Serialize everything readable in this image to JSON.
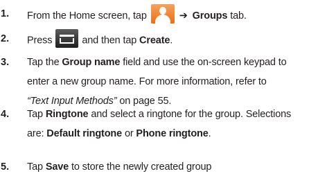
{
  "steps": [
    {
      "num": "1.",
      "lines": [
        {
          "a": "From the Home screen, tap",
          "arrow": "➔",
          "b": "Groups",
          "c": "tab."
        }
      ],
      "icon": "contacts-icon"
    },
    {
      "num": "2.",
      "lines": [
        {
          "a": "Press",
          "b": "and then tap",
          "bold": "Create",
          "c": "."
        }
      ],
      "icon": "menu-icon"
    },
    {
      "num": "3.",
      "lines": [
        {
          "pre": "Tap the",
          "bold": "Group name",
          "post": "field and use the on-screen keypad to"
        },
        {
          "text": "enter a new group name. For more information, refer to"
        },
        {
          "italic": "“Text Input Methods”",
          "post": " on page 55."
        }
      ]
    },
    {
      "num": "4.",
      "lines": [
        {
          "pre": "Tap",
          "bold": "Ringtone",
          "post": "and select a ringtone for the group. Selections"
        },
        {
          "pre": "are:",
          "bold": "Default ringtone",
          "mid": "or",
          "bold2": "Phone ringtone",
          "post": "."
        }
      ]
    },
    {
      "num": "5.",
      "lines": [
        {
          "pre": "Tap",
          "bold": "Save",
          "post": "to store the newly created group"
        }
      ]
    }
  ]
}
